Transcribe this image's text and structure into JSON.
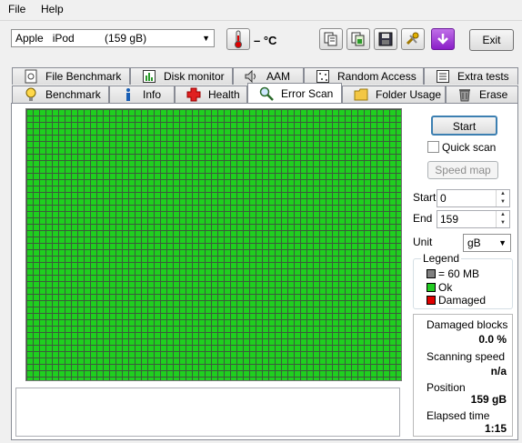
{
  "menu": {
    "file": "File",
    "help": "Help"
  },
  "toolbar": {
    "drive": "Apple   iPod          (159 gB)",
    "temperature": "– °C",
    "exit_label": "Exit"
  },
  "tabs_row1": [
    {
      "label": "File Benchmark",
      "icon": "file-benchmark-icon"
    },
    {
      "label": "Disk monitor",
      "icon": "disk-monitor-icon"
    },
    {
      "label": "AAM",
      "icon": "speaker-icon"
    },
    {
      "label": "Random Access",
      "icon": "random-access-icon"
    },
    {
      "label": "Extra tests",
      "icon": "extra-tests-icon"
    }
  ],
  "tabs_row2": [
    {
      "label": "Benchmark",
      "icon": "bulb-icon"
    },
    {
      "label": "Info",
      "icon": "info-icon"
    },
    {
      "label": "Health",
      "icon": "health-cross-icon"
    },
    {
      "label": "Error Scan",
      "icon": "magnifier-icon",
      "active": true
    },
    {
      "label": "Folder Usage",
      "icon": "folder-icon"
    },
    {
      "label": "Erase",
      "icon": "trash-icon"
    }
  ],
  "scan": {
    "start_button": "Start",
    "quick_scan_label": "Quick scan",
    "quick_scan_checked": false,
    "speed_map_button": "Speed map",
    "start_label": "Start",
    "start_value": "0",
    "end_label": "End",
    "end_value": "159",
    "unit_label": "Unit",
    "unit_value": "gB",
    "block_color_ok": "#1fcf1f",
    "progress_fraction": 1.0
  },
  "legend": {
    "title": "Legend",
    "items": [
      {
        "label": "= 60 MB",
        "color": "#808080"
      },
      {
        "label": "Ok",
        "color": "#22cc22"
      },
      {
        "label": "Damaged",
        "color": "#e00000"
      }
    ]
  },
  "stats": {
    "damaged_label": "Damaged blocks",
    "damaged_value": "0.0 %",
    "speed_label": "Scanning speed",
    "speed_value": "n/a",
    "position_label": "Position",
    "position_value": "159 gB",
    "elapsed_label": "Elapsed time",
    "elapsed_value": "1:15"
  }
}
